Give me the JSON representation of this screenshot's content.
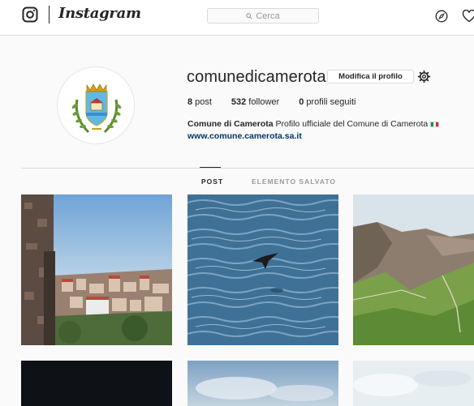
{
  "nav": {
    "brand": "Instagram",
    "search_placeholder": "Cerca"
  },
  "profile": {
    "username": "comunedicamerota",
    "edit_button": "Modifica il profilo",
    "stats": {
      "posts_count": "8",
      "posts_label": "post",
      "followers_count": "532",
      "followers_label": "follower",
      "following_count": "0",
      "following_label": "profili seguiti"
    },
    "bio": {
      "name": "Comune di Camerota",
      "text": "Profilo ufficiale del Comune di Camerota",
      "website": "www.comune.camerota.sa.it"
    }
  },
  "tabs": [
    {
      "label": "POST",
      "active": true
    },
    {
      "label": "ELEMENTO SALVATO",
      "active": false
    }
  ],
  "colors": {
    "text": "#262626",
    "border": "#dbdbdb",
    "link": "#003569",
    "muted": "#999999"
  },
  "icons": {
    "logo": "instagram-camera-icon",
    "search": "search-icon",
    "explore": "compass-icon",
    "activity": "heart-icon",
    "settings": "gear-icon",
    "flag": "italy-flag-icon"
  }
}
